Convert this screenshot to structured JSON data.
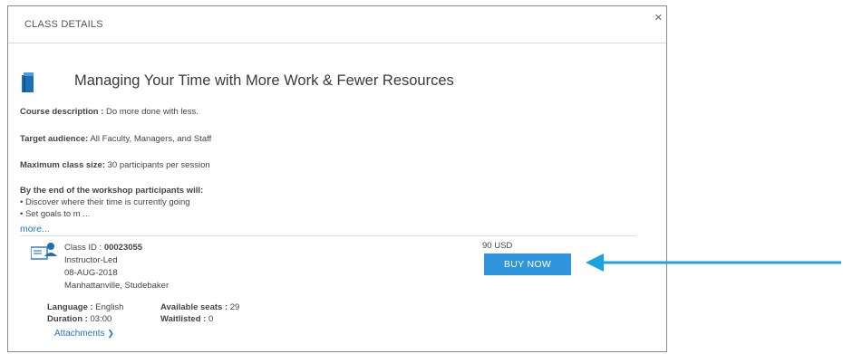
{
  "header": {
    "title": "CLASS DETAILS",
    "close_glyph": "×"
  },
  "course": {
    "title": "Managing Your Time with More Work & Fewer Resources",
    "description_label": "Course description :",
    "description": " Do more done with less.",
    "audience_label": "Target audience:",
    "audience": " All Faculty, Managers, and Staff",
    "size_label": "Maximum class size:",
    "size": " 30 participants per session",
    "outcomes_heading": "By the end of the workshop participants will:",
    "outcomes": [
      "• Discover where their time is currently going",
      "• Set goals to m ..."
    ],
    "more_link": "more..."
  },
  "class": {
    "id_label": "Class ID : ",
    "id_value": "00023055",
    "type": "Instructor-Led",
    "date": "08-AUG-2018",
    "location": "Manhattanville, Studebaker",
    "language_label": "Language :",
    "language": " English",
    "duration_label": "Duration :",
    "duration": " 03:00",
    "seats_label": "Available seats :",
    "seats": " 29",
    "waitlisted_label": "Waitlisted :",
    "waitlisted": " 0",
    "attachments_link": "Attachments",
    "attachments_chevron": "❯"
  },
  "purchase": {
    "price": "90 USD",
    "buy_label": "BUY NOW"
  },
  "colors": {
    "accent": "#2f95dc",
    "link": "#1f74c6",
    "arrow": "#1aa3e0"
  }
}
